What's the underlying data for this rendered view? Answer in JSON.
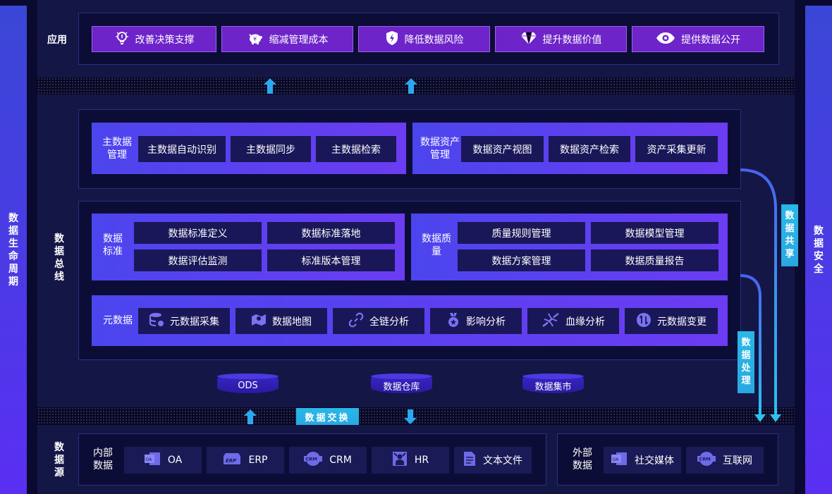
{
  "sidebars": {
    "left": "数据生命周期",
    "right": "数据安全"
  },
  "application": {
    "label": "应用",
    "buttons": [
      {
        "label": "改善决策支撑",
        "icon": "lightbulb-icon"
      },
      {
        "label": "缩减管理成本",
        "icon": "piggy-bank-icon"
      },
      {
        "label": "降低数据风险",
        "icon": "shield-icon"
      },
      {
        "label": "提升数据价值",
        "icon": "diamond-icon"
      },
      {
        "label": "提供数据公开",
        "icon": "eye-icon"
      }
    ]
  },
  "bus": {
    "label": "数据总线",
    "master": {
      "label": "主数据管理",
      "items": [
        "主数据自动识别",
        "主数据同步",
        "主数据检索"
      ]
    },
    "asset": {
      "label": "数据资产管理",
      "items": [
        "数据资产视图",
        "数据资产检索",
        "资产采集更新"
      ]
    },
    "standard": {
      "label": "数据标准",
      "items": [
        "数据标准定义",
        "数据标准落地",
        "数据评估监测",
        "标准版本管理"
      ]
    },
    "quality": {
      "label": "数据质量",
      "items": [
        "质量规则管理",
        "数据模型管理",
        "数据方案管理",
        "数据质量报告"
      ]
    },
    "metadata": {
      "label": "元数据",
      "items": [
        {
          "label": "元数据采集",
          "icon": "database-icon"
        },
        {
          "label": "数据地图",
          "icon": "map-icon"
        },
        {
          "label": "全链分析",
          "icon": "link-icon"
        },
        {
          "label": "影响分析",
          "icon": "medal-icon"
        },
        {
          "label": "血缘分析",
          "icon": "dna-icon"
        },
        {
          "label": "元数据变更",
          "icon": "transfer-icon"
        }
      ]
    },
    "stores": [
      "ODS",
      "数据仓库",
      "数据集市"
    ]
  },
  "flows": {
    "share": "数据共享",
    "process": "数据处理",
    "exchange": "数据交换"
  },
  "sources": {
    "label": "数据源",
    "internal": {
      "label": "内部数据",
      "items": [
        {
          "label": "OA",
          "icon": "oa-icon",
          "badge": "OA"
        },
        {
          "label": "ERP",
          "icon": "erp-icon",
          "badge": "ERP"
        },
        {
          "label": "CRM",
          "icon": "crm-icon",
          "badge": "CRM"
        },
        {
          "label": "HR",
          "icon": "hr-icon"
        },
        {
          "label": "文本文件",
          "icon": "document-icon"
        }
      ]
    },
    "external": {
      "label": "外部数据",
      "items": [
        {
          "label": "社交媒体",
          "icon": "oa-icon",
          "badge": "OA"
        },
        {
          "label": "互联网",
          "icon": "crm-icon",
          "badge": "CRM"
        }
      ]
    }
  },
  "colors": {
    "background": "#0a0a30",
    "accent_purple": "#6d24c8",
    "accent_blue": "#4c45ee",
    "flow_cyan": "#29b8e8"
  }
}
